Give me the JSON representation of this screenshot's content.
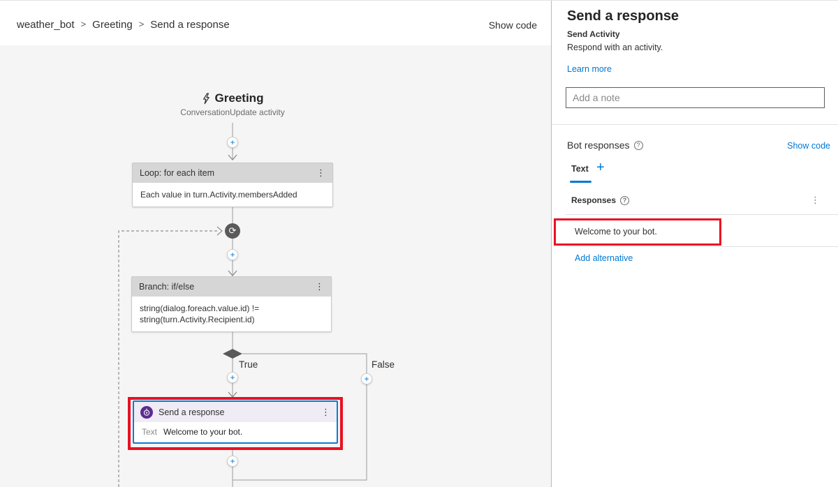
{
  "breadcrumb": {
    "items": [
      "weather_bot",
      "Greeting",
      "Send a response"
    ],
    "separator": ">",
    "show_code": "Show code"
  },
  "flow": {
    "trigger": {
      "title": "Greeting",
      "subtitle": "ConversationUpdate activity"
    },
    "loop_node": {
      "title": "Loop: for each item",
      "body": "Each value in turn.Activity.membersAdded"
    },
    "branch_node": {
      "title": "Branch: if/else",
      "body_line1": "string(dialog.foreach.value.id) !=",
      "body_line2": "string(turn.Activity.Recipient.id)"
    },
    "true_label": "True",
    "false_label": "False",
    "send_node": {
      "title": "Send a response",
      "field_label": "Text",
      "field_value": "Welcome to your bot."
    },
    "kebab_glyph": "⋮",
    "plus_glyph": "+",
    "loop_glyph": "⟳"
  },
  "panel": {
    "title": "Send a response",
    "subtitle": "Send Activity",
    "description": "Respond with an activity.",
    "learn_more": "Learn more",
    "note_placeholder": "Add a note",
    "bot_responses_label": "Bot responses",
    "help_glyph": "?",
    "show_code": "Show code",
    "tab_label": "Text",
    "tab_add_glyph": "+",
    "responses_label": "Responses",
    "responses_kebab": "⋮",
    "response_value": "Welcome to your bot.",
    "add_alternative": "Add alternative"
  },
  "colors": {
    "accent_blue": "#0078d4",
    "annotation_red": "#e81123",
    "icon_purple": "#5c2d91",
    "canvas_gray": "#f5f5f5",
    "node_header_gray": "#d6d6d6",
    "send_header_lavender": "#efecf6"
  }
}
